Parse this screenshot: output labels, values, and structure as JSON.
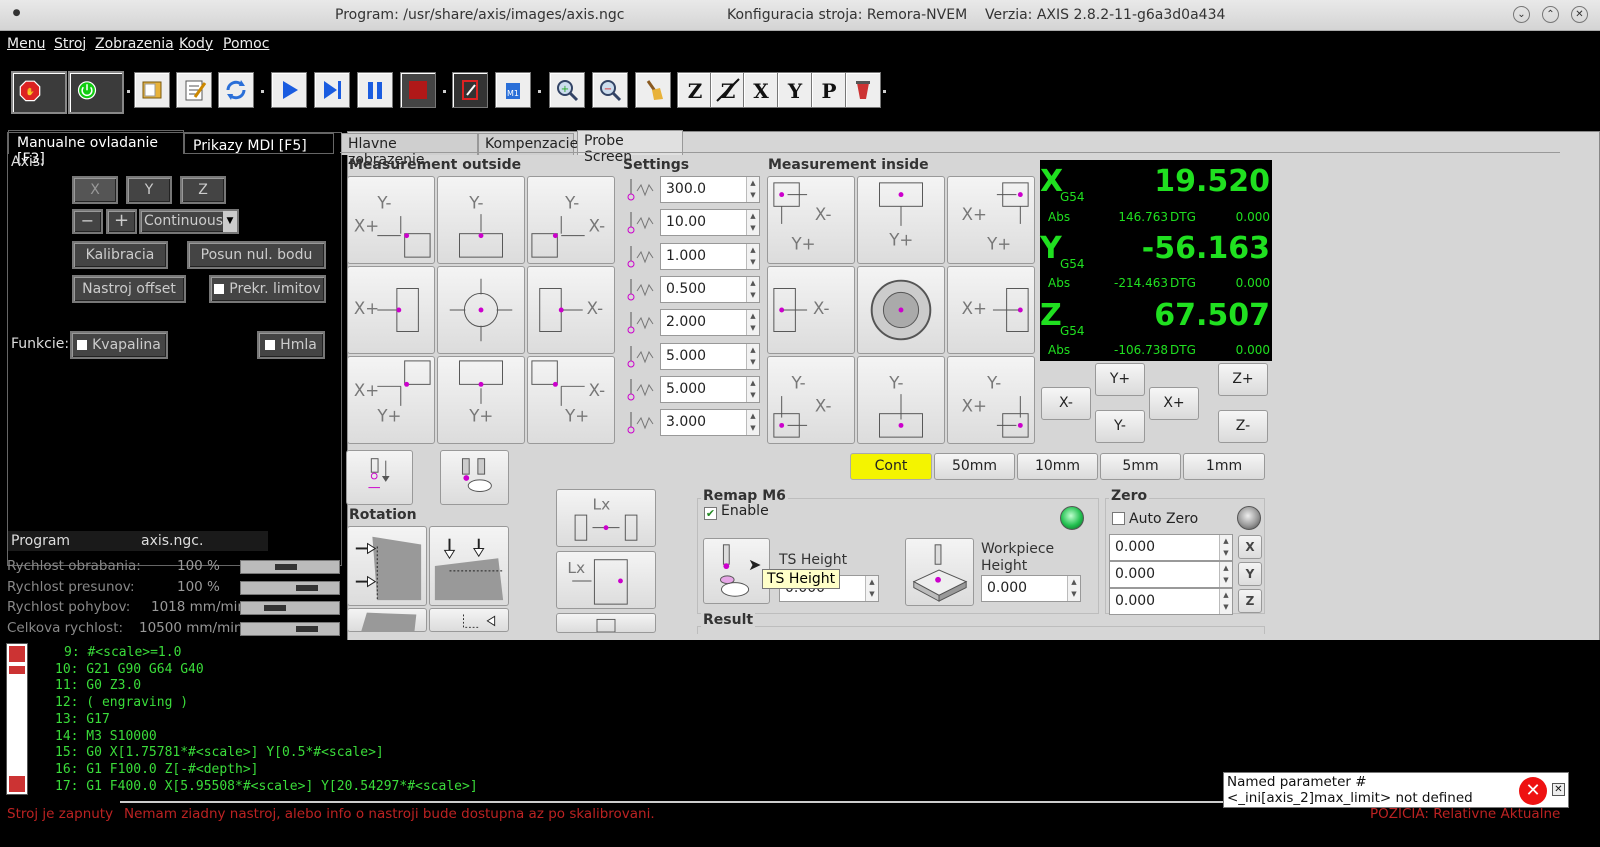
{
  "titlebar": {
    "program": "Program:  /usr/share/axis/images/axis.ngc",
    "config": "Konfiguracia stroja: Remora-NVEM",
    "version": "Verzia: AXIS 2.8.2-11-g6a3d0a434"
  },
  "menu": [
    "Menu",
    "Stroj",
    "Zobrazenia",
    "Kody",
    "Pomoc"
  ],
  "left": {
    "tabs": [
      "Manualne ovladanie [F3]",
      "Prikazy MDI [F5]"
    ],
    "axis_label": "Axis:",
    "axes": [
      "X",
      "Y",
      "Z"
    ],
    "jog_minus": "−",
    "jog_plus": "+",
    "jog_mode": "Continuous",
    "btn_calibration": "Kalibracia",
    "btn_offset_zero": "Posun nul. bodu",
    "btn_tool_offset": "Nastroj offset",
    "btn_limits": "Prekr. limitov",
    "functions_label": "Funkcie:",
    "coolant": "Kvapalina",
    "mist": "Hmla",
    "program_label": "Program",
    "program_file": "axis.ngc."
  },
  "status": [
    {
      "label": "Rychlost obrabania:",
      "value": "100 %",
      "level": 0.45
    },
    {
      "label": "Rychlost presunov:",
      "value": "100 %",
      "level": 0.72
    },
    {
      "label": "Rychlost pohybov:",
      "value": "1018 mm/min",
      "level": 0.3
    },
    {
      "label": "Celkova rychlost:",
      "value": "10500 mm/min",
      "level": 0.72
    }
  ],
  "right": {
    "tabs": [
      "Hlavne zobrazenie",
      "Kompenzacie",
      "Probe Screen"
    ],
    "outside": "Measurement outside",
    "settings": "Settings",
    "inside": "Measurement inside",
    "settings_values": [
      "300.0",
      "10.00",
      "1.000",
      "0.500",
      "2.000",
      "5.000",
      "5.000",
      "3.000"
    ],
    "rotation": "Rotation",
    "remap": "Remap M6",
    "enable": "Enable",
    "ts_height": "TS Height",
    "ts_value": "0.000",
    "tooltip": "TS Height",
    "workpiece_height": "Workpiece Height",
    "workpiece_value": "0.000",
    "zero": "Zero",
    "auto_zero": "Auto Zero",
    "zero_values": [
      "0.000",
      "0.000",
      "0.000"
    ],
    "result": "Result",
    "jog": {
      "xm": "X-",
      "yp": "Y+",
      "ym": "Y-",
      "xp": "X+",
      "zp": "Z+",
      "zm": "Z-"
    },
    "steps": [
      "Cont",
      "50mm",
      "10mm",
      "5mm",
      "1mm"
    ]
  },
  "dro": [
    {
      "axis": "X",
      "cs": "G54",
      "value": "19.520",
      "abs": "146.763",
      "dtg": "0.000"
    },
    {
      "axis": "Y",
      "cs": "G54",
      "value": "-56.163",
      "abs": "-214.463",
      "dtg": "0.000"
    },
    {
      "axis": "Z",
      "cs": "G54",
      "value": "67.507",
      "abs": "-106.738",
      "dtg": "0.000"
    }
  ],
  "dro_labels": {
    "abs": "Abs",
    "dtg": "DTG"
  },
  "gcode": [
    "9: #<scale>=1.0",
    "10: G21 G90 G64 G40",
    "11: G0 Z3.0",
    "12: ( engraving )",
    "13: G17",
    "14: M3 S10000",
    "15: G0 X[1.75781*#<scale>] Y[0.5*#<scale>]",
    "16: G1 F100.0 Z[-#<depth>]",
    "17: G1 F400.0 X[5.95508*#<scale>] Y[20.54297*#<scale>]"
  ],
  "statusbar": {
    "machine": "Stroj je zapnuty",
    "message": "Nemam ziadny nastroj, alebo info o nastroji bude dostupna az po skalibrovani.",
    "position": "POZICIA: Relativne Aktualne"
  },
  "error": "Named parameter #<_ini[axis_2]max_limit> not defined"
}
